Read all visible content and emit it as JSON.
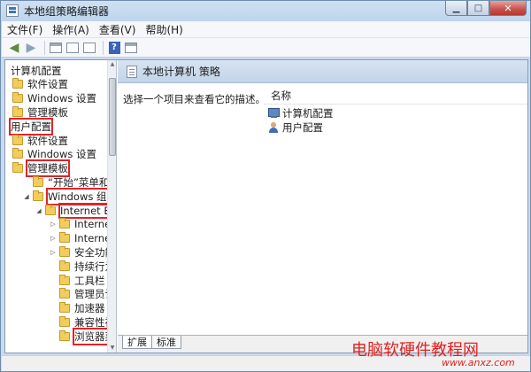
{
  "window": {
    "title": "本地组策略编辑器"
  },
  "menubar": {
    "items": [
      {
        "label": "文件(F)"
      },
      {
        "label": "操作(A)"
      },
      {
        "label": "查看(V)"
      },
      {
        "label": "帮助(H)"
      }
    ]
  },
  "tree": {
    "items": [
      {
        "label": "计算机配置",
        "indent": 0,
        "folder": false,
        "expander": "",
        "highlight": false
      },
      {
        "label": "软件设置",
        "indent": 1,
        "folder": true,
        "expander": "",
        "highlight": false
      },
      {
        "label": "Windows 设置",
        "indent": 1,
        "folder": true,
        "expander": "",
        "highlight": false
      },
      {
        "label": "管理模板",
        "indent": 1,
        "folder": true,
        "expander": "",
        "highlight": false
      },
      {
        "label": "用户配置",
        "indent": 0,
        "folder": false,
        "expander": "",
        "highlight": true
      },
      {
        "label": "软件设置",
        "indent": 1,
        "folder": true,
        "expander": "",
        "highlight": false
      },
      {
        "label": "Windows 设置",
        "indent": 1,
        "folder": true,
        "expander": "",
        "highlight": false
      },
      {
        "label": "管理模板",
        "indent": 1,
        "folder": true,
        "expander": "",
        "highlight": true
      },
      {
        "label": "“开始”菜单和任",
        "indent": 2,
        "folder": true,
        "expander": "",
        "highlight": false
      },
      {
        "label": "Windows 组件",
        "indent": 2,
        "folder": true,
        "expander": "◢",
        "highlight": true
      },
      {
        "label": "Internet Exp",
        "indent": 3,
        "folder": true,
        "expander": "◢",
        "highlight": true
      },
      {
        "label": "Internet 控",
        "indent": 4,
        "folder": true,
        "expander": "▷",
        "highlight": false
      },
      {
        "label": "Internet 设",
        "indent": 4,
        "folder": true,
        "expander": "▷",
        "highlight": false
      },
      {
        "label": "安全功能",
        "indent": 4,
        "folder": true,
        "expander": "▷",
        "highlight": false
      },
      {
        "label": "持续行为",
        "indent": 4,
        "folder": true,
        "expander": "",
        "highlight": false
      },
      {
        "label": "工具栏",
        "indent": 4,
        "folder": true,
        "expander": "",
        "highlight": false
      },
      {
        "label": "管理员认可",
        "indent": 4,
        "folder": true,
        "expander": "",
        "highlight": false
      },
      {
        "label": "加速器",
        "indent": 4,
        "folder": true,
        "expander": "",
        "highlight": false
      },
      {
        "label": "兼容性视图",
        "indent": 4,
        "folder": true,
        "expander": "",
        "highlight": false
      },
      {
        "label": "浏览器菜单",
        "indent": 4,
        "folder": true,
        "expander": "",
        "highlight": true
      }
    ]
  },
  "right": {
    "header_title": "本地计算机 策略",
    "description": "选择一个项目来查看它的描述。",
    "column_name": "名称",
    "items": [
      {
        "label": "计算机配置",
        "icon": "computer-icon"
      },
      {
        "label": "用户配置",
        "icon": "user-icon"
      }
    ]
  },
  "tabs": [
    {
      "label": "扩展",
      "active": true
    },
    {
      "label": "标准",
      "active": false
    }
  ],
  "watermark": {
    "text": "电脑软硬件教程网",
    "sub": "www.anxz.com"
  }
}
